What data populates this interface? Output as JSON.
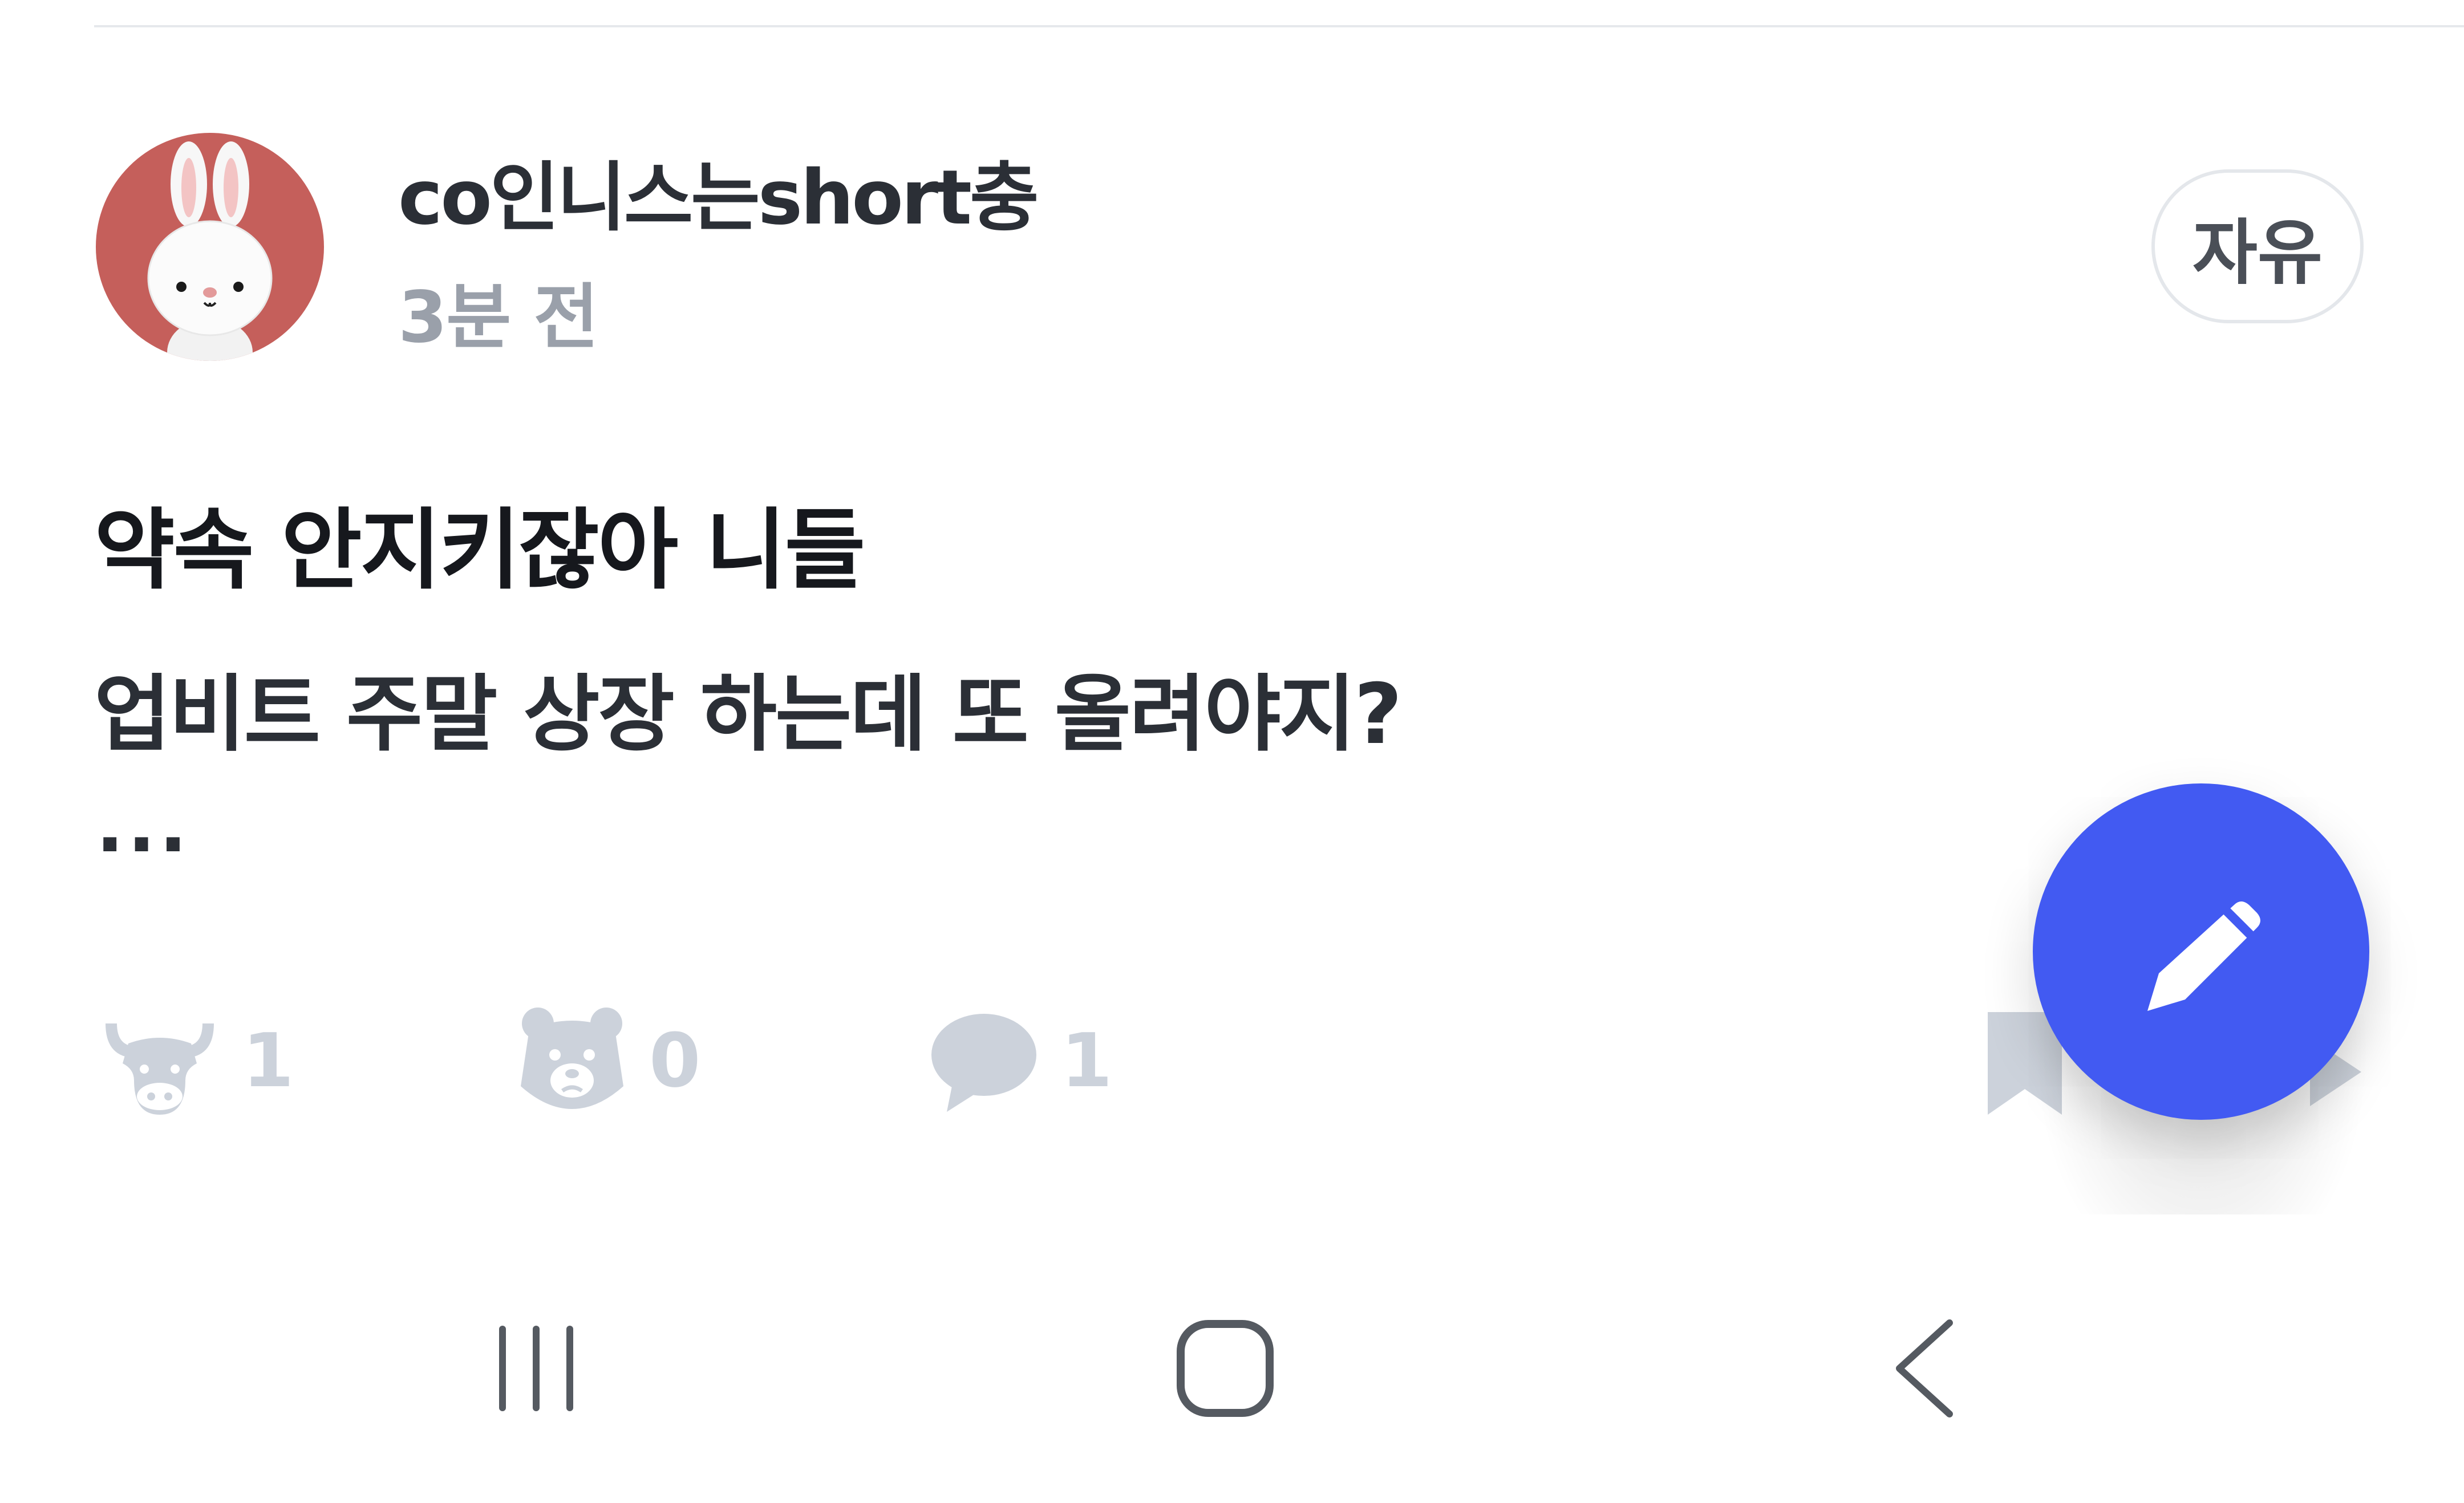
{
  "post": {
    "author": "co인니스는short충",
    "time": "3분 전",
    "category": "자유",
    "title": "약속 안지키잖아 니들",
    "body": "업비트 주말 상장 하는데 또 올려야지?",
    "more": "..."
  },
  "actions": {
    "bull": {
      "icon": "bull-icon",
      "count": "1"
    },
    "bear": {
      "icon": "bear-icon",
      "count": "0"
    },
    "comment": {
      "icon": "comment-icon",
      "count": "1"
    },
    "bookmark": {
      "icon": "bookmark-icon"
    },
    "share": {
      "icon": "share-icon"
    }
  },
  "fab": {
    "icon": "pencil-icon"
  },
  "nav": {
    "recents": "recents-icon",
    "home": "home-icon",
    "back": "back-icon"
  },
  "colors": {
    "avatar_bg": "#c55f5b",
    "fab_bg": "#425af2",
    "muted_icon": "#ccd2db",
    "timestamp": "#9aa0aa"
  }
}
